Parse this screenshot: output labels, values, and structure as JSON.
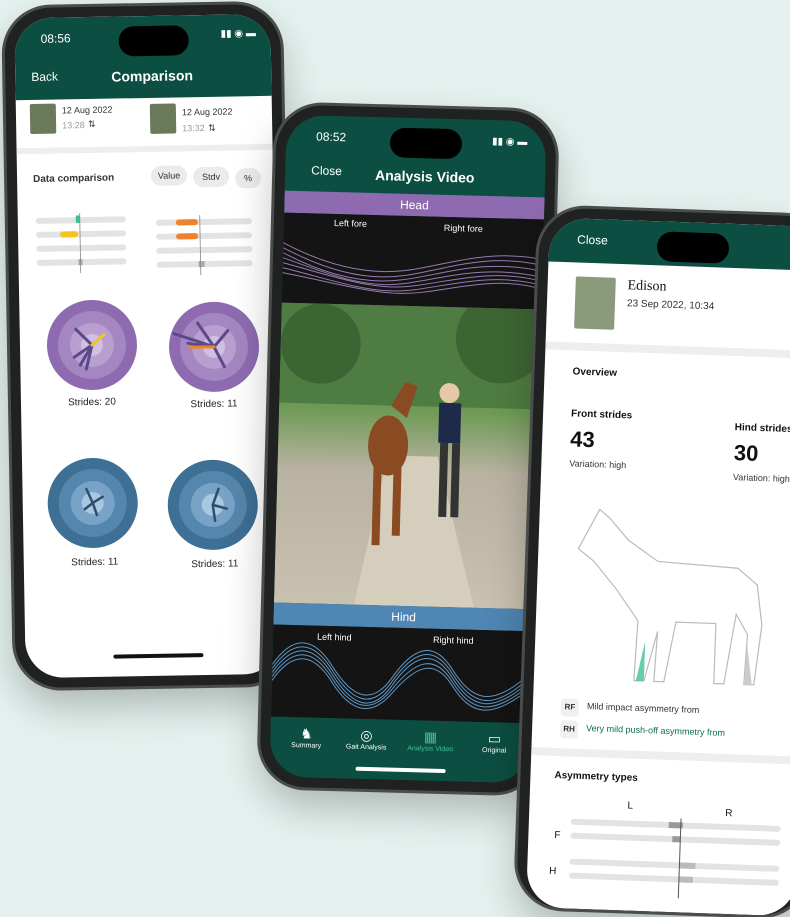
{
  "phone_left": {
    "status_time": "08:56",
    "back_label": "Back",
    "title": "Comparison",
    "recording_a": {
      "date": "12 Aug 2022",
      "time": "13:28",
      "sort_icon": "⇅"
    },
    "recording_b": {
      "date": "12 Aug 2022",
      "time": "13:32",
      "sort_icon": "⇅"
    },
    "section_title": "Data comparison",
    "toggle_buttons": [
      "Value",
      "Stdv",
      "%"
    ],
    "strides_a_top": "Strides: 20",
    "strides_b_top": "Strides: 11",
    "strides_a_bottom": "Strides: 11",
    "strides_b_bottom": "Strides: 11"
  },
  "phone_middle": {
    "status_time": "08:52",
    "close_label": "Close",
    "title": "Analysis Video",
    "head_band": "Head",
    "left_fore": "Left fore",
    "right_fore": "Right fore",
    "hind_band": "Hind",
    "left_hind": "Left hind",
    "right_hind": "Right hind",
    "tabs": [
      "Summary",
      "Gait Analysis",
      "Analysis Video",
      "Original"
    ],
    "active_tab": "Analysis Video"
  },
  "phone_right": {
    "close_label": "Close",
    "horse_name": "Edison",
    "session_datetime": "23 Sep 2022, 10:34",
    "overview_title": "Overview",
    "front_strides_label": "Front strides",
    "front_strides_value": "43",
    "front_variation": "Variation: high",
    "hind_strides_label": "Hind strides",
    "hind_strides_value": "30",
    "hind_variation": "Variation: high",
    "finding_rf_tag": "RF",
    "finding_rf_text": "Mild impact asymmetry from",
    "finding_rh_tag": "RH",
    "finding_rh_text": "Very mild push-off asymmetry from",
    "asym_title": "Asymmetry types",
    "asym_l": "L",
    "asym_r": "R",
    "asym_f": "F",
    "asym_h": "H"
  },
  "colors": {
    "accent_green": "#0c4f42",
    "purple": "#8e6bb0",
    "blue": "#4f86b3",
    "orange": "#f0822d",
    "yellow": "#f5c31b",
    "teal_highlight": "#3ec28f"
  }
}
